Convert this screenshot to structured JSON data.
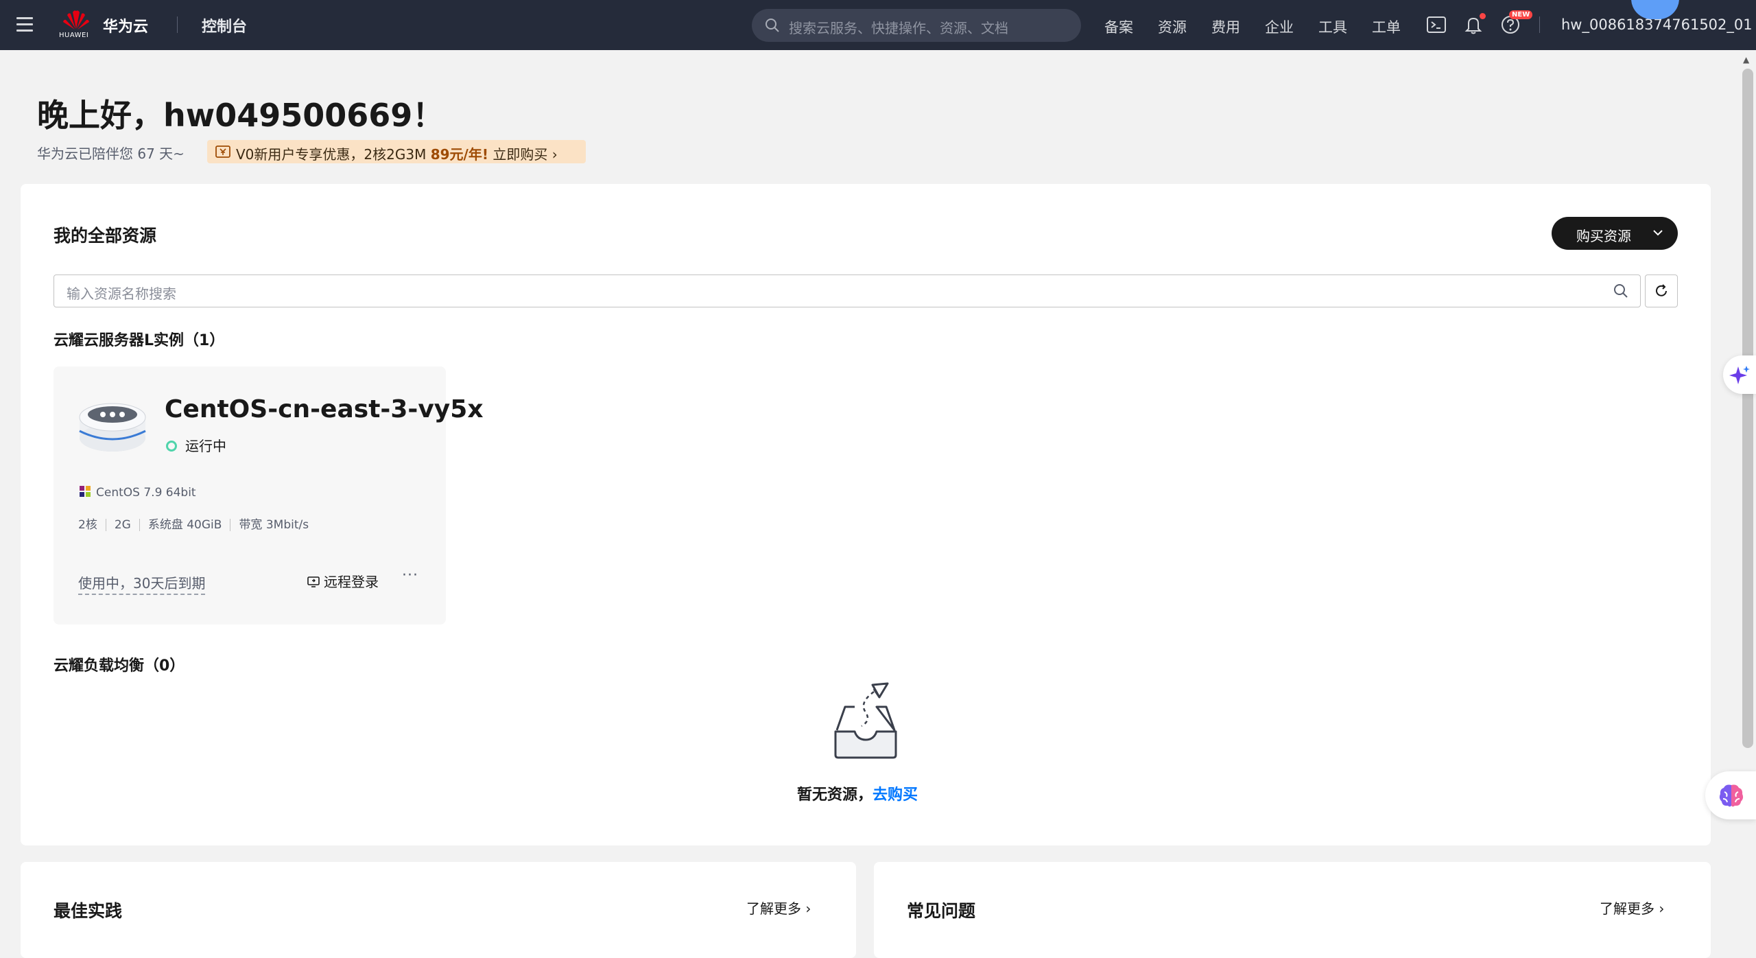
{
  "topbar": {
    "logo_text": "HUAWEI",
    "brand": "华为云",
    "console": "控制台",
    "search_placeholder": "搜索云服务、快捷操作、资源、文档",
    "nav": [
      "备案",
      "资源",
      "费用",
      "企业",
      "工具",
      "工单"
    ],
    "new_badge": "NEW",
    "user": "hw_008618374761502_01"
  },
  "greeting": {
    "title": "晚上好，hw049500669！",
    "days": "华为云已陪伴您 67 天~",
    "promo_text": "V0新用户专享优惠，2核2G3M ",
    "promo_price": "89元/年!",
    "promo_cta": " 立即购买"
  },
  "resources": {
    "title": "我的全部资源",
    "buy_button": "购买资源",
    "search_placeholder": "输入资源名称搜索",
    "l_section": "云耀云服务器L实例（1）",
    "instance": {
      "name": "CentOS-cn-east-3-vy5x",
      "status": "运行中",
      "os": "CentOS 7.9 64bit",
      "specs": [
        "2核",
        "2G",
        "系统盘 40GiB",
        "带宽 3Mbit/s"
      ],
      "expire": "使用中，30天后到期",
      "remote": "远程登录",
      "more": "···"
    },
    "lb_section": "云耀负载均衡（0）",
    "empty_text": "暂无资源，",
    "empty_link": "去购买"
  },
  "best": {
    "title": "最佳实践",
    "more": "了解更多"
  },
  "faq": {
    "title": "常见问题",
    "more": "了解更多"
  },
  "colors": {
    "topbar": "#252b3a",
    "status_running": "#50d4ab",
    "link": "#0077ff",
    "promo_bg": "#fbe2c5"
  }
}
